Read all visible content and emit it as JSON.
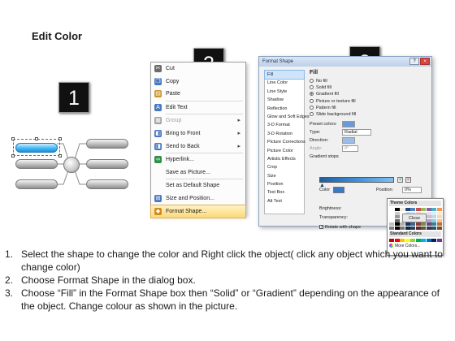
{
  "title": "Edit Color",
  "badges": [
    "1",
    "2",
    "3"
  ],
  "context_menu": {
    "items": [
      {
        "label": "Cut",
        "icon": "scissors-icon",
        "color": "#6b6b6b"
      },
      {
        "label": "Copy",
        "icon": "copy-icon",
        "color": "#4a78c0"
      },
      {
        "label": "Paste",
        "icon": "paste-icon",
        "color": "#c9952c"
      },
      {
        "label": "Edit Text",
        "icon": "edit-text-icon",
        "color": "#4a78c0"
      },
      {
        "label": "Group",
        "icon": "group-icon",
        "color": "#a0a0a0",
        "disabled": true,
        "submenu": true
      },
      {
        "label": "Bring to Front",
        "icon": "bring-front-icon",
        "color": "#4a78c0",
        "submenu": true
      },
      {
        "label": "Send to Back",
        "icon": "send-back-icon",
        "color": "#4a78c0",
        "submenu": true
      },
      {
        "label": "Hyperlink...",
        "icon": "hyperlink-icon",
        "color": "#2f8f4a"
      },
      {
        "label": "Save as Picture...",
        "icon": "",
        "color": ""
      },
      {
        "label": "Set as Default Shape",
        "icon": "",
        "color": ""
      },
      {
        "label": "Size and Position...",
        "icon": "size-position-icon",
        "color": "#4a78c0"
      },
      {
        "label": "Format Shape...",
        "icon": "format-shape-icon",
        "color": "#d08a1e",
        "highlighted": true
      }
    ]
  },
  "dialog": {
    "title": "Format Shape",
    "nav": [
      "Fill",
      "Line Color",
      "Line Style",
      "Shadow",
      "Reflection",
      "Glow and Soft Edges",
      "3-D Format",
      "3-D Rotation",
      "Picture Corrections",
      "Picture Color",
      "Artistic Effects",
      "Crop",
      "Size",
      "Position",
      "Text Box",
      "Alt Text"
    ],
    "fill_heading": "Fill",
    "fill_options": [
      {
        "label": "No fill",
        "selected": false
      },
      {
        "label": "Solid fill",
        "selected": false
      },
      {
        "label": "Gradient fill",
        "selected": true
      },
      {
        "label": "Picture or texture fill",
        "selected": false
      },
      {
        "label": "Pattern fill",
        "selected": false
      },
      {
        "label": "Slide background fill",
        "selected": false
      }
    ],
    "preset_colors_label": "Preset colors:",
    "type_label": "Type:",
    "type_value": "Radial",
    "direction_label": "Direction:",
    "angle_label": "Angle:",
    "angle_value": "0°",
    "gradient_stops_label": "Gradient stops",
    "color_label": "Color",
    "position_label": "Position:",
    "position_value": "0%",
    "brightness_label": "Brightness:",
    "transparency_label": "Transparency:",
    "rotate_label": "Rotate with shape",
    "theme_colors_label": "Theme Colors",
    "standard_colors_label": "Standard Colors",
    "more_colors_label": "More Colors...",
    "close_label": "Close",
    "theme_palette": [
      "#ffffff",
      "#000000",
      "#eeece1",
      "#1f497d",
      "#4f81bd",
      "#c0504d",
      "#9bbb59",
      "#8064a2",
      "#4bacc6",
      "#f79646"
    ],
    "standard_palette": [
      "#c00000",
      "#ff0000",
      "#ffc000",
      "#ffff00",
      "#92d050",
      "#00b050",
      "#00b0f0",
      "#0070c0",
      "#002060",
      "#7030a0"
    ]
  },
  "instructions": [
    {
      "num": "1.",
      "text": "Select the shape to change the color and Right click the object( click any object which you want to change color)"
    },
    {
      "num": "2.",
      "text": "Choose Format Shape in the dialog box."
    },
    {
      "num": "3.",
      "text": "Choose “Fill” in the Format Shape box then “Solid” or “Gradient” depending on the appearance of the object. Change colour as shown in the picture."
    }
  ]
}
